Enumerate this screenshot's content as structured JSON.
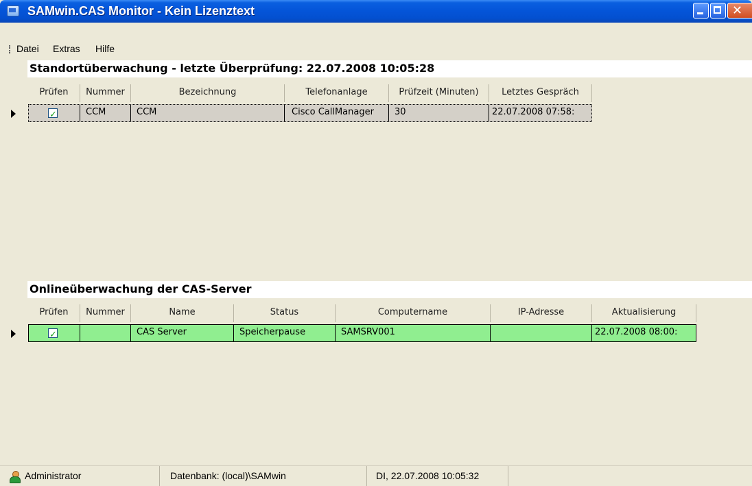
{
  "window": {
    "title": "SAMwin.CAS Monitor - Kein Lizenztext",
    "close_glyph": "✕"
  },
  "menu": {
    "items": [
      "Datei",
      "Extras",
      "Hilfe"
    ]
  },
  "location_section": {
    "title": "Standortüberwachung - letzte Überprüfung: 22.07.2008 10:05:28",
    "columns": [
      "Prüfen",
      "Nummer",
      "Bezeichnung",
      "Telefonanlage",
      "Prüfzeit (Minuten)",
      "Letztes Gespräch"
    ],
    "rows": [
      {
        "checked": true,
        "nummer": "CCM",
        "bezeichnung": "CCM",
        "telefonanlage": "Cisco CallManager",
        "pruefzeit": "30",
        "letztes_gespraech": "22.07.2008 07:58:"
      }
    ]
  },
  "server_section": {
    "title": "Onlineüberwachung der CAS-Server",
    "columns": [
      "Prüfen",
      "Nummer",
      "Name",
      "Status",
      "Computername",
      "IP-Adresse",
      "Aktualisierung"
    ],
    "rows": [
      {
        "checked": true,
        "nummer": "",
        "name": "CAS Server",
        "status": "Speicherpause",
        "computername": "SAMSRV001",
        "ip_adresse": "",
        "aktualisierung": "22.07.2008 08:00:"
      }
    ]
  },
  "statusbar": {
    "user": "Administrator",
    "database": "Datenbank: (local)\\SAMwin",
    "datetime": "DI, 22.07.2008 10:05:32"
  },
  "colors": {
    "title_blue": "#0454d8",
    "row_selected_gray": "#d4d0c8",
    "row_ok_green": "#90ee90",
    "check_green": "#21a121"
  },
  "icons": {
    "app": "monitor-icon",
    "user": "user-icon",
    "check": "checkmark-icon",
    "row_pointer": "row-pointer-icon"
  }
}
